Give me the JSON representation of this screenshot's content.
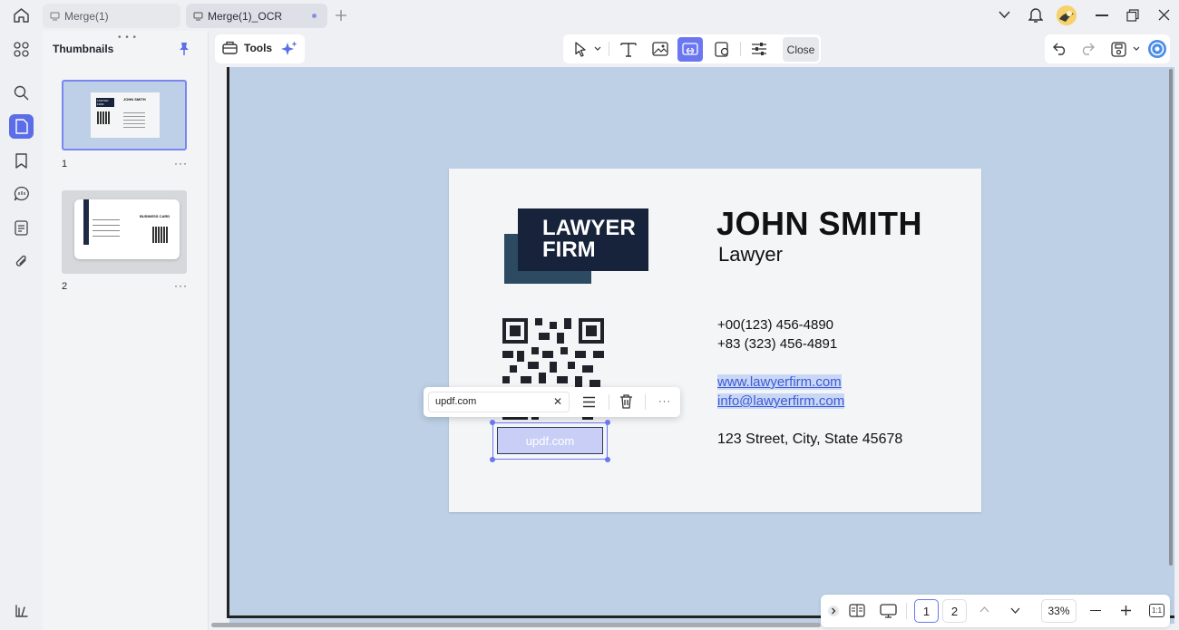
{
  "tabs": [
    {
      "label": "Merge(1)"
    },
    {
      "label": "Merge(1)_OCR"
    }
  ],
  "panel": {
    "title": "Thumbnails",
    "pages": [
      {
        "number": "1",
        "more": "···"
      },
      {
        "number": "2",
        "more": "···"
      }
    ],
    "thumb1": {
      "logo": "LAWYER FIRM",
      "name": "JOHN SMITH"
    },
    "thumb2": {
      "heading": "BUSINESS CARD"
    }
  },
  "toolbar": {
    "tools_label": "Tools",
    "close_label": "Close"
  },
  "card": {
    "logo_line1": "LAWYER",
    "logo_line2": "FIRM",
    "name": "JOHN SMITH",
    "role": "Lawyer",
    "phone1": "+00(123) 456-4890",
    "phone2": "+83 (323) 456-4891",
    "website": "www.lawyerfirm.com",
    "email": "info@lawyerfirm.com",
    "address": "123 Street, City, State 45678"
  },
  "link_editor": {
    "value": "updf.com",
    "clear": "✕",
    "more": "···"
  },
  "selected_text": "updf.com",
  "pagenav": {
    "page1": "1",
    "page2": "2",
    "zoom": "33%",
    "fit": "1:1"
  },
  "colors": {
    "accent": "#6a77f0",
    "canvas": "#bdd0e6",
    "logo_dark": "#17233a",
    "logo_back": "#2c4a62",
    "link": "#3b5bd6"
  }
}
